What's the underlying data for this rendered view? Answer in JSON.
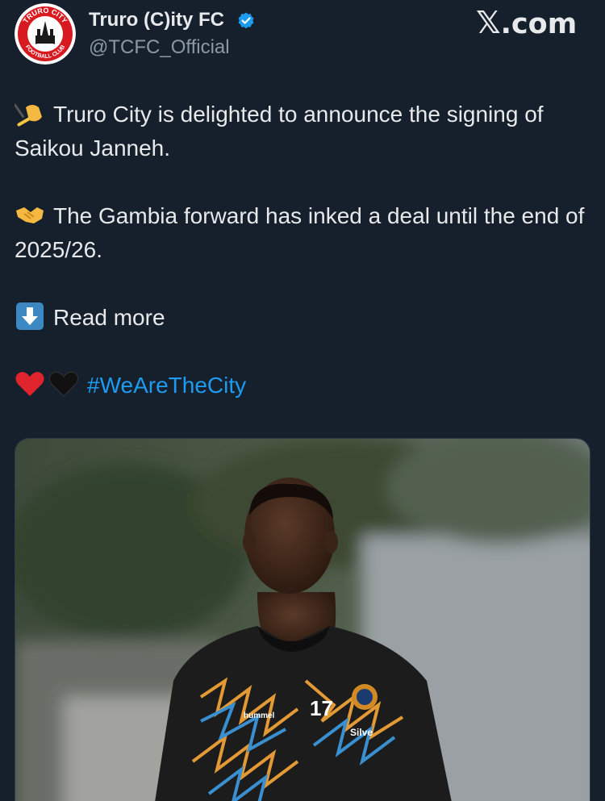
{
  "author": {
    "name": "Truro (C)ity FC",
    "handle": "@TCFC_Official",
    "verified": true,
    "avatar_arc_top": "TRURO CITY",
    "avatar_arc_bottom": "FOOTBALL CLUB"
  },
  "brand": {
    "logo_text": ".com",
    "logo_mark": "𝕏"
  },
  "tweet": {
    "line1": "Truro City is delighted to announce the signing of Saikou Janneh.",
    "line2": "The Gambia forward has inked a deal until the end of 2025/26.",
    "line3": "Read more",
    "hashtag": "#WeAreTheCity",
    "icons": [
      "writing-hand-emoji",
      "handshake-emoji",
      "down-arrow-emoji",
      "red-heart-emoji",
      "black-heart-emoji"
    ]
  },
  "media": {
    "shirt_number": "17",
    "shirt_brand": "hummel",
    "shirt_sponsor": "Silve"
  },
  "colors": {
    "background": "#16202c",
    "text": "#e7e9ea",
    "muted": "#8b98a5",
    "link": "#1d9bf0",
    "verified": "#1d9bf0",
    "club_red": "#d71920"
  }
}
